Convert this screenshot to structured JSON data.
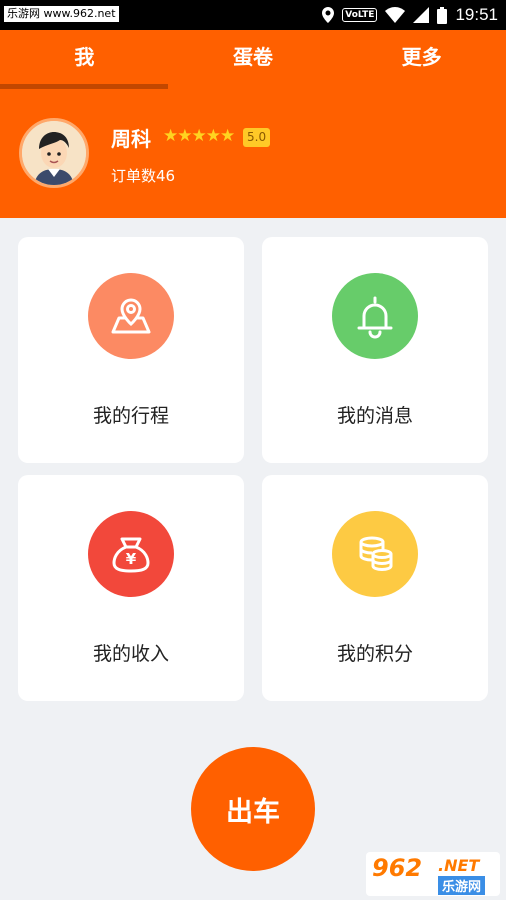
{
  "status_bar": {
    "site": "乐游网 www.962.net",
    "network": "VoLTE",
    "time": "19:51"
  },
  "tabs": [
    {
      "label": "我",
      "active": true
    },
    {
      "label": "蛋卷",
      "active": false
    },
    {
      "label": "更多",
      "active": false
    }
  ],
  "profile": {
    "name": "周科",
    "stars": "★★★★★",
    "rating": "5.0",
    "orders": "订单数46"
  },
  "menu": [
    {
      "label": "我的行程",
      "icon": "map-pin-icon",
      "color": "#fc8a63"
    },
    {
      "label": "我的消息",
      "icon": "bell-icon",
      "color": "#67cc6a"
    },
    {
      "label": "我的收入",
      "icon": "money-bag-icon",
      "color": "#f2483b"
    },
    {
      "label": "我的积分",
      "icon": "coins-icon",
      "color": "#fdca43"
    }
  ],
  "go_button": "出车",
  "watermark": {
    "num": "962",
    "net": ".NET",
    "cn": "乐游网"
  },
  "colors": {
    "brand": "#ff6000",
    "background": "#eff1f4"
  }
}
